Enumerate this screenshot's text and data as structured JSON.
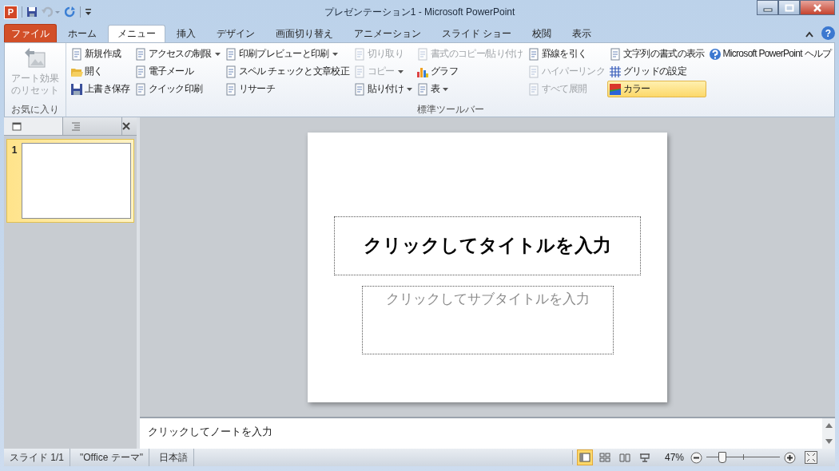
{
  "window": {
    "title": "プレゼンテーション1 - Microsoft PowerPoint",
    "app_icon_letter": "P"
  },
  "quick_access": [
    {
      "disabled": false
    },
    {
      "disabled": true
    },
    {
      "disabled": false
    }
  ],
  "file_tab": "ファイル",
  "tabs": [
    {
      "label": "ホーム",
      "selected": false
    },
    {
      "label": "メニュー",
      "selected": true
    },
    {
      "label": "挿入",
      "selected": false
    },
    {
      "label": "デザイン",
      "selected": false
    },
    {
      "label": "画面切り替え",
      "selected": false
    },
    {
      "label": "アニメーション",
      "selected": false
    },
    {
      "label": "スライド ショー",
      "selected": false
    },
    {
      "label": "校閲",
      "selected": false
    },
    {
      "label": "表示",
      "selected": false
    }
  ],
  "help_button": "?",
  "ribbon": {
    "favorites": {
      "label": "お気に入り",
      "button": {
        "label": "アート効果のリセット",
        "disabled": true
      }
    },
    "toolbar": {
      "label": "標準ツールバー",
      "columns": [
        [
          {
            "label": "新規作成",
            "disabled": false,
            "dropdown": false,
            "selected": false
          },
          {
            "label": "開く",
            "disabled": false,
            "dropdown": false,
            "selected": false
          },
          {
            "label": "上書き保存",
            "disabled": false,
            "dropdown": false,
            "selected": false
          }
        ],
        [
          {
            "label": "アクセスの制限",
            "disabled": false,
            "dropdown": true,
            "selected": false
          },
          {
            "label": "電子メール",
            "disabled": false,
            "dropdown": false,
            "selected": false
          },
          {
            "label": "クイック印刷",
            "disabled": false,
            "dropdown": false,
            "selected": false
          }
        ],
        [
          {
            "label": "印刷プレビューと印刷",
            "disabled": false,
            "dropdown": true,
            "selected": false
          },
          {
            "label": "スペル チェックと文章校正",
            "disabled": false,
            "dropdown": false,
            "selected": false
          },
          {
            "label": "リサーチ",
            "disabled": false,
            "dropdown": false,
            "selected": false
          }
        ],
        [
          {
            "label": "切り取り",
            "disabled": true,
            "dropdown": false,
            "selected": false
          },
          {
            "label": "コピー",
            "disabled": true,
            "dropdown": true,
            "selected": false
          },
          {
            "label": "貼り付け",
            "disabled": false,
            "dropdown": true,
            "selected": false
          }
        ],
        [
          {
            "label": "書式のコピー/貼り付け",
            "disabled": true,
            "dropdown": false,
            "selected": false
          },
          {
            "label": "グラフ",
            "disabled": false,
            "dropdown": false,
            "selected": false
          },
          {
            "label": "表",
            "disabled": false,
            "dropdown": true,
            "selected": false
          }
        ],
        [
          {
            "label": "罫線を引く",
            "disabled": false,
            "dropdown": false,
            "selected": false
          },
          {
            "label": "ハイパーリンク",
            "disabled": true,
            "dropdown": false,
            "selected": false
          },
          {
            "label": "すべて展開",
            "disabled": true,
            "dropdown": false,
            "selected": false
          }
        ],
        [
          {
            "label": "文字列の書式の表示",
            "disabled": false,
            "dropdown": false,
            "selected": false
          },
          {
            "label": "グリッドの設定",
            "disabled": false,
            "dropdown": false,
            "selected": false
          },
          {
            "label": "カラー",
            "disabled": false,
            "dropdown": false,
            "selected": true
          }
        ],
        [
          {
            "label": "Microsoft PowerPoint ヘルプ",
            "disabled": false,
            "dropdown": false,
            "selected": false
          }
        ]
      ]
    }
  },
  "slides_pane": {
    "tabs": [
      {
        "selected": true
      },
      {
        "selected": false
      }
    ],
    "thumbnails": [
      {
        "number": "1",
        "selected": true
      }
    ]
  },
  "slide": {
    "title_placeholder": "クリックしてタイトルを入力",
    "subtitle_placeholder": "クリックしてサブタイトルを入力"
  },
  "notes": {
    "placeholder": "クリックしてノートを入力"
  },
  "status_bar": {
    "items": [
      "スライド 1/1",
      "\"Office テーマ\"",
      "日本語"
    ],
    "views": [
      {
        "selected": true
      },
      {
        "selected": false
      },
      {
        "selected": false
      },
      {
        "selected": false
      }
    ],
    "zoom": "47%",
    "zoom_slider": {
      "level": 0.21
    }
  }
}
